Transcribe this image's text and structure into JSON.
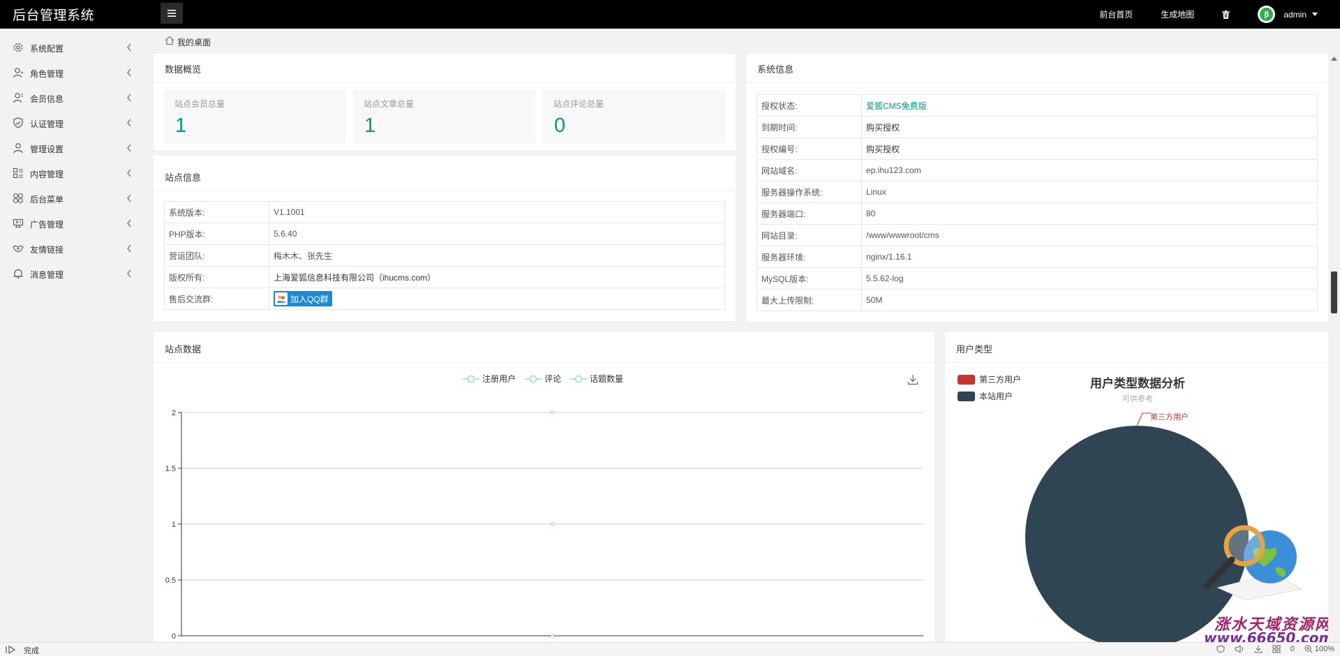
{
  "header": {
    "brand": "后台管理系统",
    "links": [
      "前台首页",
      "生成地图"
    ],
    "username": "admin"
  },
  "sidebar": {
    "items": [
      {
        "label": "系统配置",
        "icon": "gear-icon"
      },
      {
        "label": "角色管理",
        "icon": "user-icon"
      },
      {
        "label": "会员信息",
        "icon": "member-icon"
      },
      {
        "label": "认证管理",
        "icon": "shield-icon"
      },
      {
        "label": "管理设置",
        "icon": "user-icon"
      },
      {
        "label": "内容管理",
        "icon": "content-icon"
      },
      {
        "label": "后台菜单",
        "icon": "menu-grid-icon"
      },
      {
        "label": "广告管理",
        "icon": "ad-icon"
      },
      {
        "label": "友情链接",
        "icon": "handshake-icon"
      },
      {
        "label": "消息管理",
        "icon": "bell-icon"
      }
    ]
  },
  "breadcrumb": {
    "label": "我的桌面"
  },
  "overview": {
    "title": "数据概览",
    "stats": [
      {
        "label": "站点会员总量",
        "value": "1"
      },
      {
        "label": "站点文章总量",
        "value": "1"
      },
      {
        "label": "站点评论总量",
        "value": "0"
      }
    ]
  },
  "site_info": {
    "title": "站点信息",
    "rows": [
      {
        "key": "系统版本:",
        "value": "V1.1001"
      },
      {
        "key": "PHP版本:",
        "value": "5.6.40"
      },
      {
        "key": "营运团队:",
        "value": "梅木木、张先生"
      },
      {
        "key": "版权所有:",
        "value": "上海爱狐信息科技有限公司（ihucms.com）"
      },
      {
        "key": "售后交流群:",
        "value": "加入QQ群"
      }
    ]
  },
  "system_info": {
    "title": "系统信息",
    "rows": [
      {
        "key": "授权状态:",
        "value": "爱狐CMS免费版"
      },
      {
        "key": "到期时间:",
        "value": "购买授权"
      },
      {
        "key": "授权编号:",
        "value": "购买授权"
      },
      {
        "key": "网站域名:",
        "value": "ep.ihu123.com"
      },
      {
        "key": "服务器操作系统:",
        "value": "Linux"
      },
      {
        "key": "服务器端口:",
        "value": "80"
      },
      {
        "key": "网站目录:",
        "value": "/www/wwwroot/cms"
      },
      {
        "key": "服务器环境:",
        "value": "nginx/1.16.1"
      },
      {
        "key": "MySQL版本:",
        "value": "5.5.62-log"
      },
      {
        "key": "最大上传限制:",
        "value": "50M"
      }
    ]
  },
  "site_data": {
    "title": "站点数据"
  },
  "user_type": {
    "title": "用户类型"
  },
  "chart_data": [
    {
      "type": "line",
      "title": "",
      "series": [
        {
          "name": "注册用户",
          "values": [
            1
          ]
        },
        {
          "name": "评论",
          "values": [
            0
          ]
        },
        {
          "name": "话题数量",
          "values": [
            2
          ]
        }
      ],
      "ylim": [
        0,
        2
      ],
      "yticks": [
        "2",
        "1.5",
        "1",
        "0.5",
        "0"
      ],
      "grid": true,
      "legend": "top-center",
      "colors": [
        "#8fe0d0",
        "#8fe0d0",
        "#8fe0d0"
      ]
    },
    {
      "type": "pie",
      "title": "用户类型数据分析",
      "subtitle": "可供参考",
      "slices": [
        {
          "name": "第三方用户",
          "value": 0,
          "color": "#c23531"
        },
        {
          "name": "本站用户",
          "value": 1,
          "color": "#2f4554"
        }
      ],
      "legend": "top-left",
      "callout_label": "第三方用户"
    }
  ],
  "status_bar": {
    "text": "完成",
    "right": [
      "0",
      "100%"
    ]
  },
  "watermark": "涨水天域资源网 www.66650.com"
}
